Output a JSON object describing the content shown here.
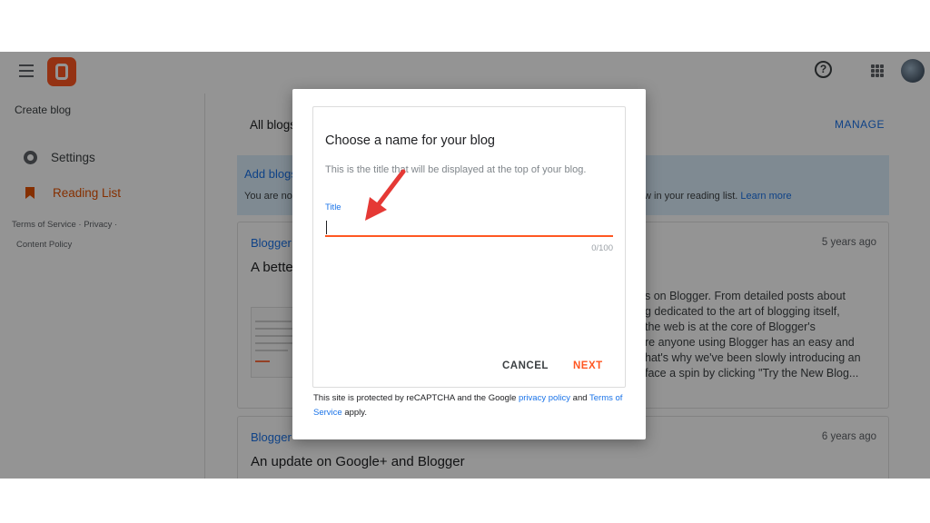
{
  "topbar": {
    "menu_icon": "hamburger-menu-icon",
    "logo_icon": "blogger-logo-icon",
    "help_glyph": "?",
    "apps_icon": "google-apps-grid-icon",
    "avatar_icon": "account-avatar"
  },
  "sidebar": {
    "create_blog": "Create blog",
    "settings_label": "Settings",
    "reading_list_label": "Reading List",
    "terms": "Terms of Service",
    "sep": "·",
    "privacy": "Privacy",
    "content_policy": "Content Policy"
  },
  "main": {
    "all_blogs": "All blogs",
    "manage": "MANAGE",
    "banner": {
      "title": "Add blogs",
      "text": "You are no",
      "tail": "w in your reading list.",
      "learn_more": "Learn more"
    },
    "cards": [
      {
        "source": "Blogger",
        "time": "5 years ago",
        "title": "A bette",
        "excerpt": "s on Blogger. From detailed posts about\ng dedicated to the art of blogging itself,\n the web is at the core of Blogger's\nre anyone using Blogger has an easy and\nhat's why we've been slowly introducing an\nface a spin by clicking \"Try the New Blog..."
      },
      {
        "source": "Blogger",
        "time": "6 years ago",
        "title": "An update on Google+ and Blogger"
      }
    ]
  },
  "dialog": {
    "title": "Choose a name for your blog",
    "subtitle": "This is the title that will be displayed at the top of your blog.",
    "field_label": "Title",
    "field_value": "",
    "counter": "0/100",
    "cancel": "CANCEL",
    "next": "NEXT",
    "recaptcha_text": "This site is protected by reCAPTCHA and the Google",
    "privacy_policy": "privacy policy",
    "and": "and",
    "terms_of_service": "Terms of Service",
    "apply": "apply."
  },
  "colors": {
    "accent_orange": "#ff5722",
    "link_blue": "#1a73e8",
    "annotation_arrow": "#e53935"
  }
}
